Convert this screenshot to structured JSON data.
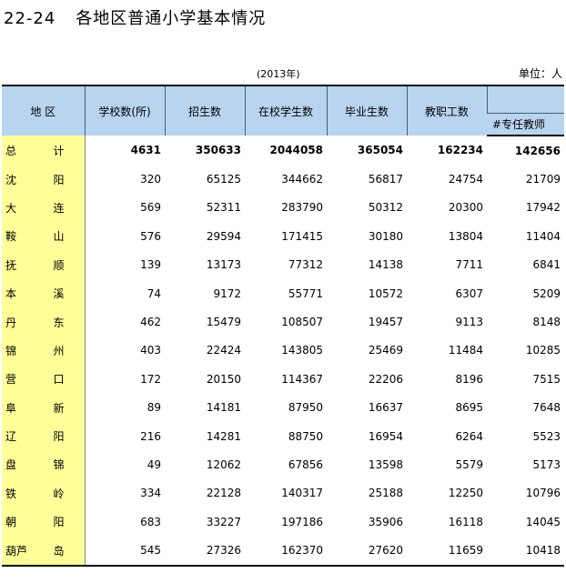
{
  "title": {
    "number": "22-24",
    "text": "各地区普通小学基本情况"
  },
  "year": "(2013年)",
  "unit": "单位：人",
  "headers": {
    "region": "地  区",
    "schools": "学校数(所)",
    "enroll": "招生数",
    "students": "在校学生数",
    "graduates": "毕业生数",
    "staff": "教职工数",
    "teachers": "#专任教师"
  },
  "rows": [
    {
      "r1": "总",
      "r2": "计",
      "schools": "4631",
      "enroll": "350633",
      "students": "2044058",
      "graduates": "365054",
      "staff": "162234",
      "teachers": "142656"
    },
    {
      "r1": "沈",
      "r2": "阳",
      "schools": "320",
      "enroll": "65125",
      "students": "344662",
      "graduates": "56817",
      "staff": "24754",
      "teachers": "21709"
    },
    {
      "r1": "大",
      "r2": "连",
      "schools": "569",
      "enroll": "52311",
      "students": "283790",
      "graduates": "50312",
      "staff": "20300",
      "teachers": "17942"
    },
    {
      "r1": "鞍",
      "r2": "山",
      "schools": "576",
      "enroll": "29594",
      "students": "171415",
      "graduates": "30180",
      "staff": "13804",
      "teachers": "11404"
    },
    {
      "r1": "抚",
      "r2": "顺",
      "schools": "139",
      "enroll": "13173",
      "students": "77312",
      "graduates": "14138",
      "staff": "7711",
      "teachers": "6841"
    },
    {
      "r1": "本",
      "r2": "溪",
      "schools": "74",
      "enroll": "9172",
      "students": "55771",
      "graduates": "10572",
      "staff": "6307",
      "teachers": "5209"
    },
    {
      "r1": "丹",
      "r2": "东",
      "schools": "462",
      "enroll": "15479",
      "students": "108507",
      "graduates": "19457",
      "staff": "9113",
      "teachers": "8148"
    },
    {
      "r1": "锦",
      "r2": "州",
      "schools": "403",
      "enroll": "22424",
      "students": "143805",
      "graduates": "25469",
      "staff": "11484",
      "teachers": "10285"
    },
    {
      "r1": "营",
      "r2": "口",
      "schools": "172",
      "enroll": "20150",
      "students": "114367",
      "graduates": "22206",
      "staff": "8196",
      "teachers": "7515"
    },
    {
      "r1": "阜",
      "r2": "新",
      "schools": "89",
      "enroll": "14181",
      "students": "87950",
      "graduates": "16637",
      "staff": "8695",
      "teachers": "7648"
    },
    {
      "r1": "辽",
      "r2": "阳",
      "schools": "216",
      "enroll": "14281",
      "students": "88750",
      "graduates": "16954",
      "staff": "6264",
      "teachers": "5523"
    },
    {
      "r1": "盘",
      "r2": "锦",
      "schools": "49",
      "enroll": "12062",
      "students": "67856",
      "graduates": "13598",
      "staff": "5579",
      "teachers": "5173"
    },
    {
      "r1": "铁",
      "r2": "岭",
      "schools": "334",
      "enroll": "22128",
      "students": "140317",
      "graduates": "25188",
      "staff": "12250",
      "teachers": "10796"
    },
    {
      "r1": "朝",
      "r2": "阳",
      "schools": "683",
      "enroll": "33227",
      "students": "197186",
      "graduates": "35906",
      "staff": "16118",
      "teachers": "14045"
    },
    {
      "r1": "葫芦",
      "r2": "岛",
      "schools": "545",
      "enroll": "27326",
      "students": "162370",
      "graduates": "27620",
      "staff": "11659",
      "teachers": "10418"
    }
  ]
}
